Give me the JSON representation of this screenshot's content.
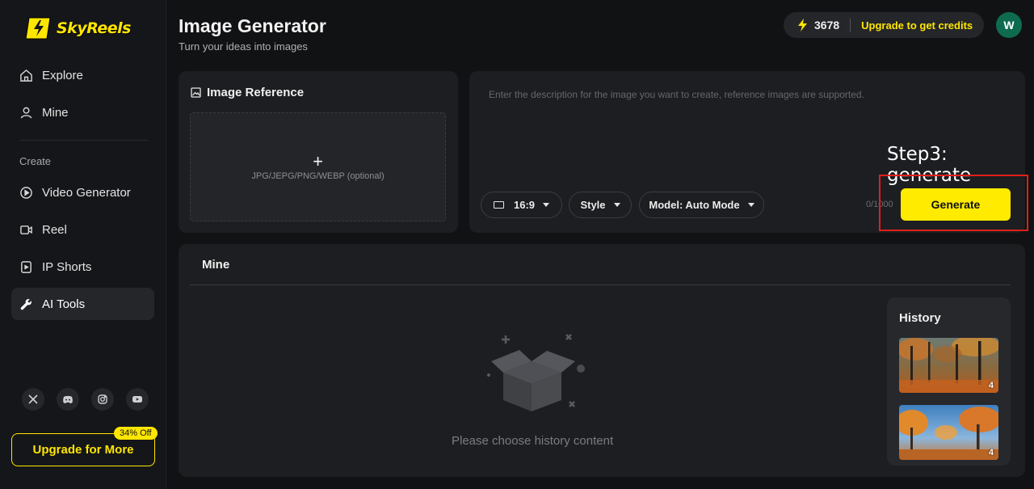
{
  "brand": {
    "name": "SkyReels",
    "accent": "#ffe600"
  },
  "sidebar": {
    "items": [
      {
        "label": "Explore",
        "icon": "home-icon"
      },
      {
        "label": "Mine",
        "icon": "user-icon"
      }
    ],
    "section_label": "Create",
    "create_items": [
      {
        "label": "Video Generator",
        "icon": "play-circle-icon"
      },
      {
        "label": "Reel",
        "icon": "video-camera-icon"
      },
      {
        "label": "IP Shorts",
        "icon": "shorts-icon"
      },
      {
        "label": "AI Tools",
        "icon": "wrench-icon",
        "active": true
      }
    ],
    "socials": [
      "x-icon",
      "discord-icon",
      "instagram-icon",
      "youtube-icon"
    ],
    "upgrade_label": "Upgrade for More",
    "discount_badge": "34% Off"
  },
  "header": {
    "title": "Image Generator",
    "subtitle": "Turn your ideas into images",
    "credits": "3678",
    "upgrade_label": "Upgrade to get credits",
    "avatar_initial": "W"
  },
  "reference": {
    "title": "Image Reference",
    "plus": "+",
    "hint": "JPG/JEPG/PNG/WEBP (optional)"
  },
  "prompt": {
    "placeholder": "Enter the description for the image you want to create, reference images are supported.",
    "value": "",
    "ratio": "16:9",
    "style": "Style",
    "model": "Model: Auto Mode",
    "char_count": "0/1000",
    "generate_label": "Generate"
  },
  "annotation": {
    "step_label": "Step3: generate",
    "highlight_color": "#e0201b"
  },
  "mine": {
    "title": "Mine",
    "empty_text": "Please choose history content"
  },
  "history": {
    "title": "History",
    "items": [
      {
        "count": "4",
        "theme": "autumn-forest"
      },
      {
        "count": "4",
        "theme": "autumn-trees-blue-sky"
      }
    ]
  }
}
